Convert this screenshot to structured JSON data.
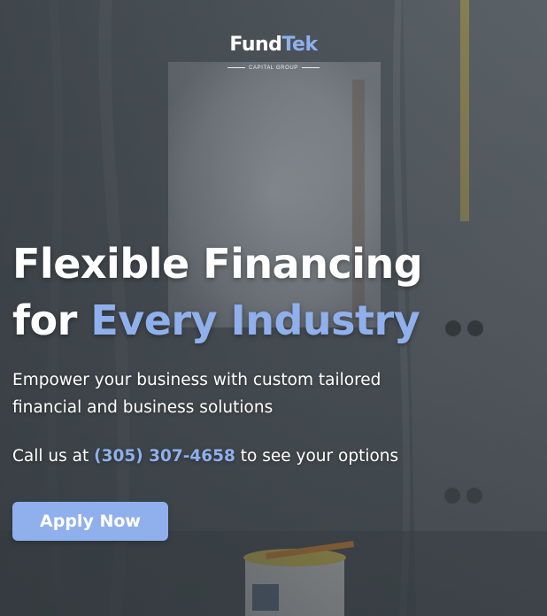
{
  "logo": {
    "word_primary": "Fund",
    "word_accent": "Tek",
    "tagline": "CAPITAL GROUP"
  },
  "hero": {
    "headline_line1": "Flexible Financing",
    "headline_for": "for ",
    "headline_accent": "Every Industry",
    "subcopy": "Empower your business with custom tailored financial and business solutions",
    "call_prefix": "Call us at ",
    "phone": "(305) 307-4658",
    "call_suffix": " to see your options",
    "cta_label": "Apply Now"
  },
  "colors": {
    "accent": "#8fb0ec",
    "text": "#ffffff",
    "overlay": "#3e454b"
  },
  "background": {
    "description_icon": "construction-room-photo"
  }
}
